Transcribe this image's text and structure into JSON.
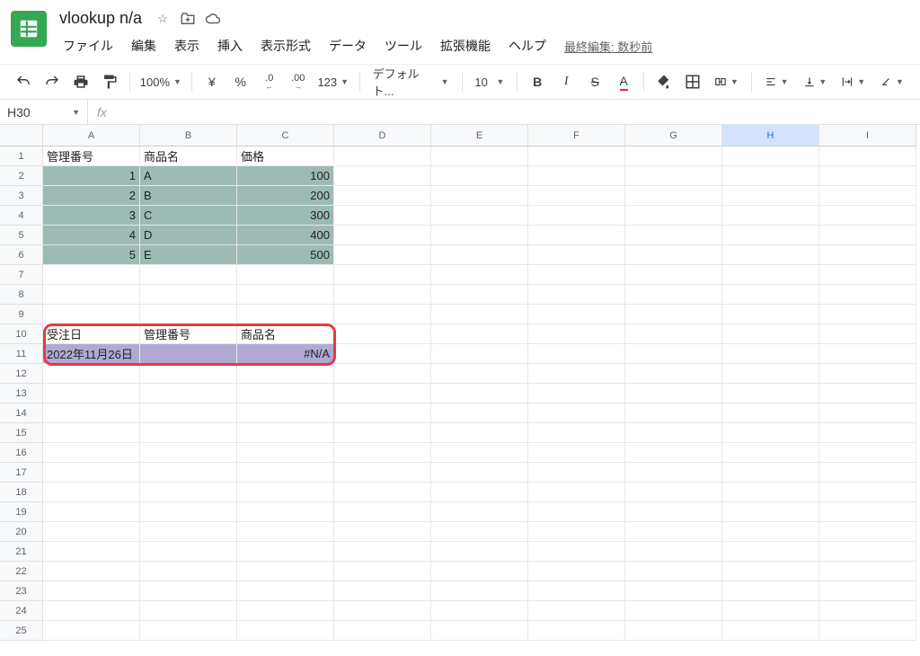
{
  "doc": {
    "title": "vlookup n/a"
  },
  "menus": [
    "ファイル",
    "編集",
    "表示",
    "挿入",
    "表示形式",
    "データ",
    "ツール",
    "拡張機能",
    "ヘルプ"
  ],
  "last_edit": "最終編集: 数秒前",
  "toolbar": {
    "zoom": "100%",
    "currency": "¥",
    "percent": "%",
    "dec_dec": ".0",
    "dec_inc": ".00",
    "numfmt": "123",
    "font": "デフォルト...",
    "fontsize": "10",
    "bold": "B",
    "italic": "I",
    "strike": "S",
    "text_color": "A"
  },
  "name_box": "H30",
  "columns": [
    "A",
    "B",
    "C",
    "D",
    "E",
    "F",
    "G",
    "H",
    "I"
  ],
  "rows_count": 25,
  "sheet": {
    "r1": {
      "A": "管理番号",
      "B": "商品名",
      "C": "価格"
    },
    "r2": {
      "A": "1",
      "B": "A",
      "C": "100"
    },
    "r3": {
      "A": "2",
      "B": "B",
      "C": "200"
    },
    "r4": {
      "A": "3",
      "B": "C",
      "C": "300"
    },
    "r5": {
      "A": "4",
      "B": "D",
      "C": "400"
    },
    "r6": {
      "A": "5",
      "B": "E",
      "C": "500"
    },
    "r10": {
      "A": "受注日",
      "B": "管理番号",
      "C": "商品名"
    },
    "r11": {
      "A": "2022年11月26日",
      "B": "",
      "C": "#N/A"
    }
  },
  "chart_data": {
    "type": "table",
    "tables": [
      {
        "headers": [
          "管理番号",
          "商品名",
          "価格"
        ],
        "rows": [
          [
            1,
            "A",
            100
          ],
          [
            2,
            "B",
            200
          ],
          [
            3,
            "C",
            300
          ],
          [
            4,
            "D",
            400
          ],
          [
            5,
            "E",
            500
          ]
        ]
      },
      {
        "headers": [
          "受注日",
          "管理番号",
          "商品名"
        ],
        "rows": [
          [
            "2022年11月26日",
            "",
            "#N/A"
          ]
        ]
      }
    ]
  }
}
